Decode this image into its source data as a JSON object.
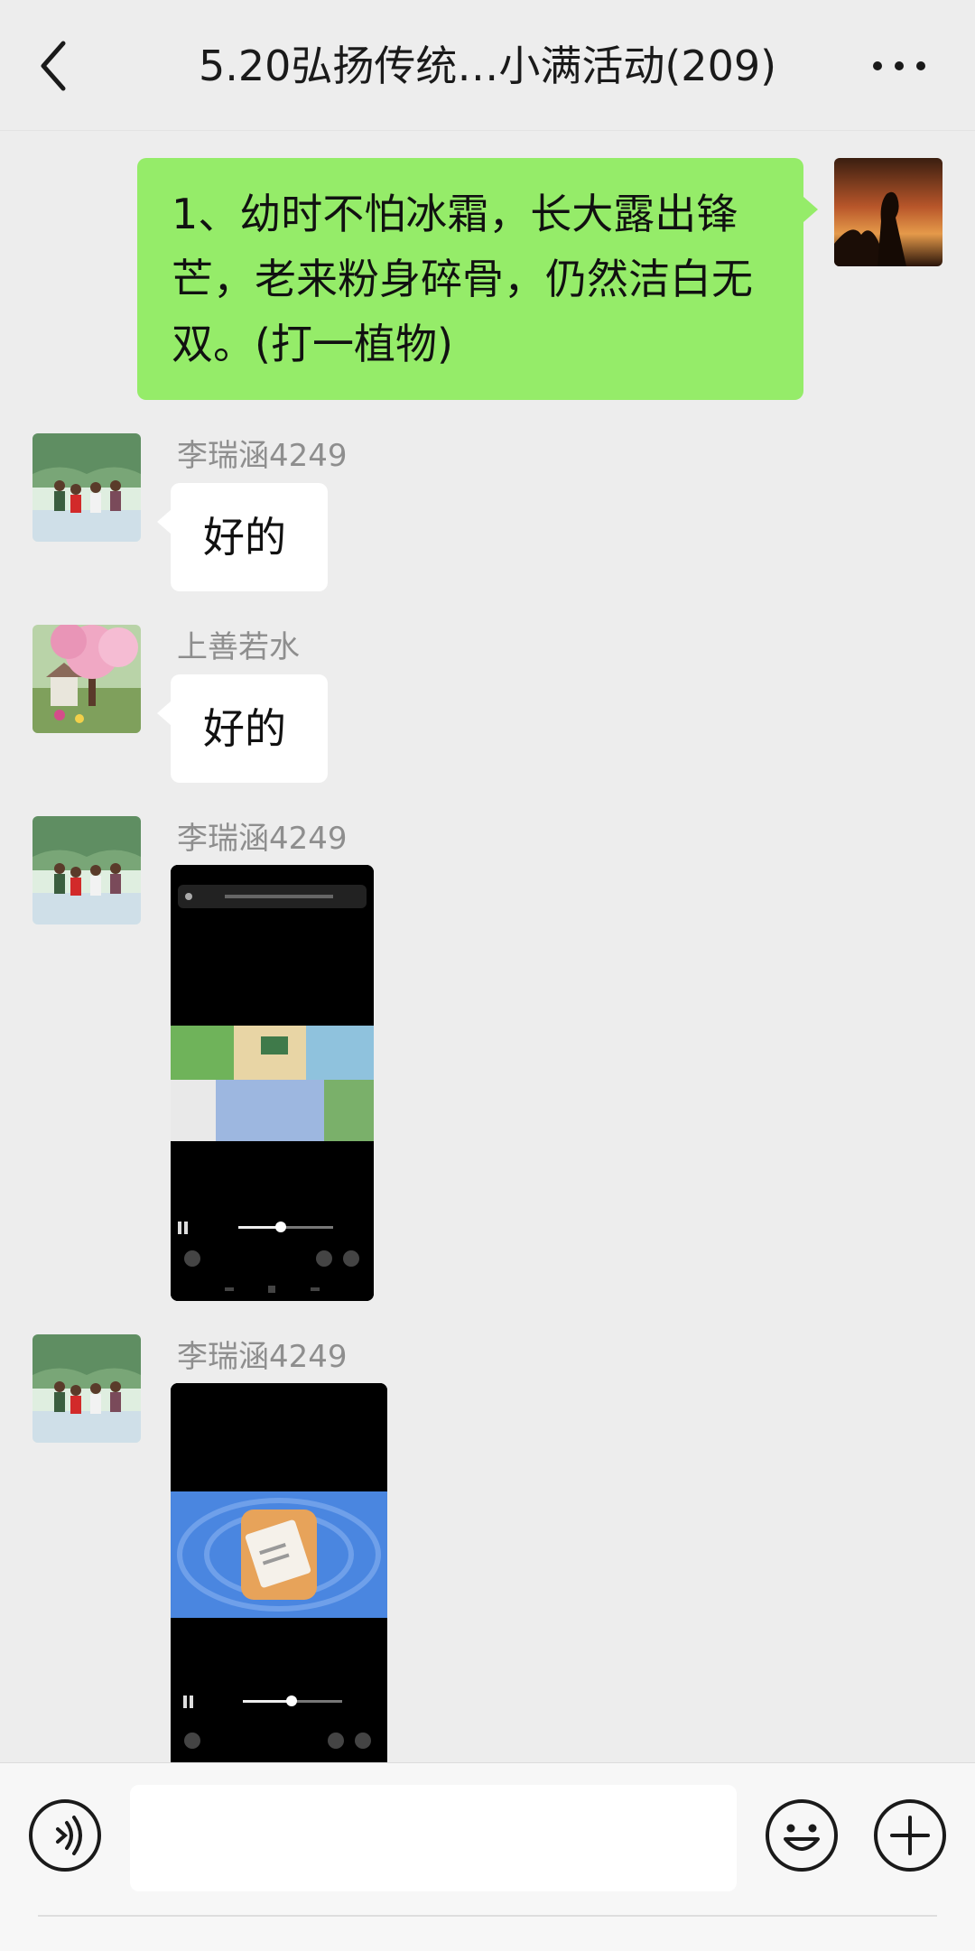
{
  "header": {
    "title": "5.20弘扬传统…小满活动(209)"
  },
  "messages": [
    {
      "side": "right",
      "text": "1、幼时不怕冰霜，长大露出锋芒，老来粉身碎骨，仍然洁白无双。(打一植物)",
      "lines": [
        "1、幼时不怕冰霜，长大露出锋",
        "芒，老来粉身碎骨，仍然洁白无",
        "双。(打一植物)"
      ]
    },
    {
      "side": "left",
      "sender": "李瑞涵4249",
      "text": "好的"
    },
    {
      "side": "left",
      "sender": "上善若水",
      "text": "好的"
    },
    {
      "side": "left",
      "sender": "李瑞涵4249",
      "type": "video"
    },
    {
      "side": "left",
      "sender": "李瑞涵4249",
      "type": "video"
    }
  ],
  "input_bar": {
    "voice_icon": "voice-icon",
    "emoji_icon": "emoji-icon",
    "plus_icon": "plus-icon"
  },
  "colors": {
    "background": "#ededed",
    "my_bubble": "#95ec69",
    "other_bubble": "#ffffff"
  }
}
